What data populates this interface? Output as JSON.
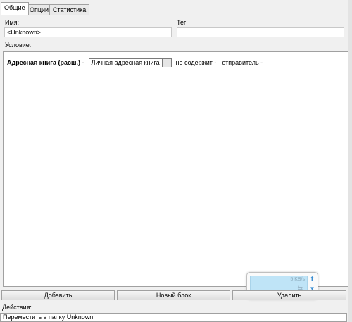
{
  "tabs": [
    {
      "label": "Общие",
      "active": true
    },
    {
      "label": "Опции",
      "active": false
    },
    {
      "label": "Статистика",
      "active": false
    }
  ],
  "general": {
    "name_label": "Имя:",
    "name_value": "<Unknown>",
    "tag_label": "Тег:",
    "tag_value": "",
    "condition_label": "Условие:"
  },
  "condition": {
    "field": "Адресная книга (расш.) -",
    "book_value": "Личная адресная книга",
    "browse_label": "...",
    "operator": "не содержит -",
    "target": "отправитель -"
  },
  "net_widget": {
    "speed": "5 KB/s",
    "accent": "#bfe4f7"
  },
  "buttons": {
    "add": "Добавить",
    "new_block": "Новый блок",
    "delete": "Удалить"
  },
  "actions": {
    "label": "Действия:",
    "items": [
      "Переместить в папку Unknown"
    ]
  }
}
